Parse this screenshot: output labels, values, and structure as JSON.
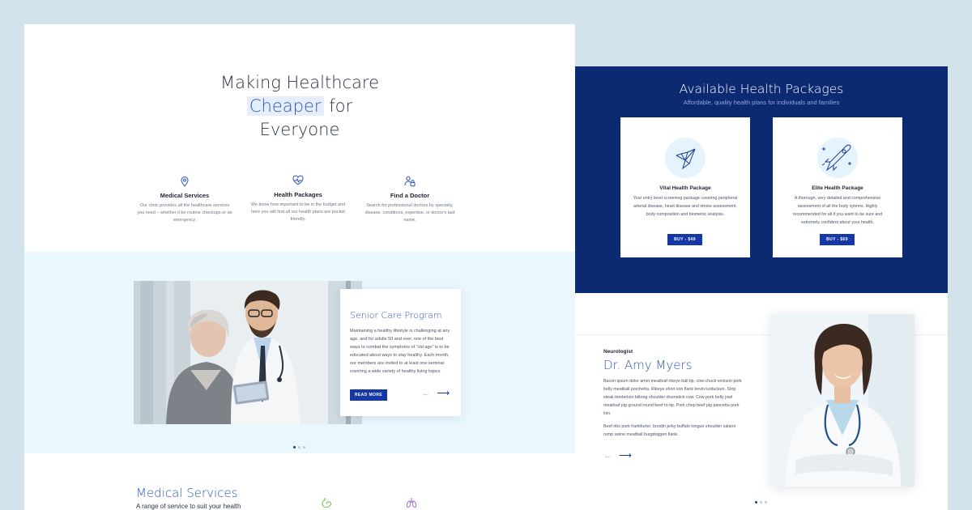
{
  "hero": {
    "title_line1": "Making Healthcare",
    "title_highlight": "Cheaper",
    "title_for": " for",
    "title_line3": "Everyone"
  },
  "features": [
    {
      "icon": "stethoscope-pin-icon",
      "title": "Medical Services",
      "text": "Our clinic provides all the healthcare services you need – whether it be routine checkups or an emergency."
    },
    {
      "icon": "heart-pulse-icon",
      "title": "Health Packages",
      "text": "We know how important to be in the budget and here you will find all our health plans are pocket friendly."
    },
    {
      "icon": "doctor-lock-icon",
      "title": "Find a Doctor",
      "text": "Search for professional doctors by specialty, disease, conditions, expertise, or doctor's last name."
    }
  ],
  "senior_care": {
    "title": "Senior Care Program",
    "text": "Maintaining a healthy lifestyle is challenging at any age, and for adults 50 and over, one of the best ways to combat the symptoms of “old age” is to be educated about ways to stay healthy. Each month, our members are invited to at least one seminar covering a wide variety of healthy living topics.",
    "button": "READ MORE",
    "prev_arrow": "←",
    "next_arrow": "⟶"
  },
  "medical_services": {
    "title": "Medical Services",
    "subtitle": "A range of service to suit your health"
  },
  "packages": {
    "title": "Available Health Packages",
    "subtitle": "Affordable, quality health plans for individuals and families",
    "cards": [
      {
        "icon": "origami-bird-icon",
        "title": "Vital Health Package",
        "text": "Your entry level screening package covering peripheral arterial disease, heart disease and stroke assessment, body composition and biometric analysis.",
        "button": "BUY - $49"
      },
      {
        "icon": "rocket-icon",
        "title": "Elite Health Package",
        "text": "A thorough, very detailed and comprehensive assessment of all the body sytems. Highly recommended for all if you want to be sure and extremely confident about your health.",
        "button": "BUY - $69"
      }
    ]
  },
  "doctor": {
    "role": "Neurologist",
    "name": "Dr. Amy Myers",
    "bio1": "Bacon ipsum dolor amet meatloaf ribeye ball tip, cow chuck venison pork belly meatball porchetta. Ribeye short loin flank kevin turducken. Strip steak tenderloin biltong shoulder drumstick cow. Cow pork belly jowl meatloaf pig ground round beef tri-tip. Pork chop beef pig pancetta pork loin.",
    "bio2": "Beef ribs pork frankfurter, boudin jerky buffalo tongue shoulder salami rump swine meatball burgdoggen flank.",
    "prev_arrow": "←",
    "next_arrow": "⟶"
  },
  "colors": {
    "accent_blue": "#2f55b8",
    "navy": "#0c2a72",
    "button_blue": "#1537a8",
    "light_band": "#eaf7fd",
    "backdrop": "#d3e3ec"
  }
}
